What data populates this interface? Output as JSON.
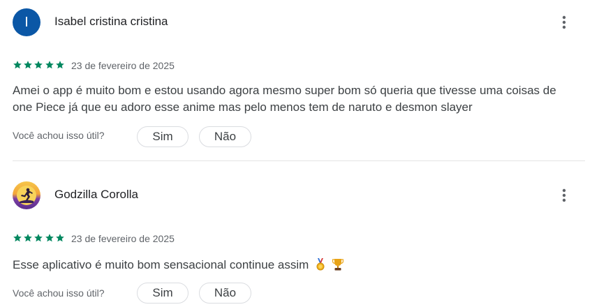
{
  "reviews": [
    {
      "author": "Isabel cristina cristina",
      "avatar_letter": "I",
      "avatar_color": "#0b57a6",
      "rating": 5,
      "date": "23 de fevereiro de 2025",
      "text": "Amei o app é muito bom e estou usando agora mesmo super bom só queria que tivesse uma coisas de one Piece já que eu adoro esse anime mas pelo menos tem de naruto e desmon slayer",
      "helpful_prompt": "Você achou isso útil?",
      "yes_label": "Sim",
      "no_label": "Não"
    },
    {
      "author": "Godzilla Corolla",
      "avatar_icon": "surfer-sunset-avatar",
      "rating": 5,
      "date": "23 de fevereiro de 2025",
      "text": "Esse aplicativo é muito bom sensacional continue assim",
      "emojis": [
        "medal-icon",
        "trophy-icon"
      ],
      "helpful_prompt": "Você achou isso útil?",
      "yes_label": "Sim",
      "no_label": "Não"
    }
  ],
  "colors": {
    "star": "#01875f",
    "divider": "#e3e3e3",
    "pill_border": "#dadce0"
  }
}
